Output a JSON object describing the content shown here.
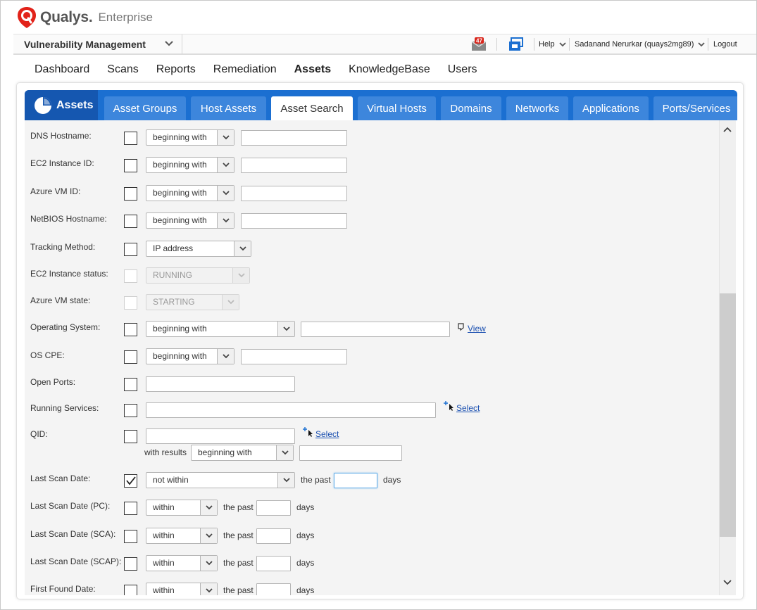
{
  "brand": {
    "name": "Qualys.",
    "edition": "Enterprise"
  },
  "topbar": {
    "module": "Vulnerability Management",
    "mail_count": "47",
    "help": "Help",
    "user": "Sadanand Nerurkar (quays2mg89)",
    "logout": "Logout"
  },
  "nav": [
    "Dashboard",
    "Scans",
    "Reports",
    "Remediation",
    "Assets",
    "KnowledgeBase",
    "Users"
  ],
  "tabs": {
    "home": "Assets",
    "items": [
      "Asset Groups",
      "Host Assets",
      "Asset Search",
      "Virtual Hosts",
      "Domains",
      "Networks",
      "Applications",
      "Ports/Services"
    ]
  },
  "form": {
    "dns_hostname": {
      "label": "DNS Hostname:",
      "operator": "beginning with"
    },
    "ec2_instance_id": {
      "label": "EC2 Instance ID:",
      "operator": "beginning with"
    },
    "azure_vm_id": {
      "label": "Azure VM ID:",
      "operator": "beginning with"
    },
    "netbios_hostname": {
      "label": "NetBIOS Hostname:",
      "operator": "beginning with"
    },
    "tracking_method": {
      "label": "Tracking Method:",
      "value": "IP address"
    },
    "ec2_instance_status": {
      "label": "EC2 Instance status:",
      "value": "RUNNING"
    },
    "azure_vm_state": {
      "label": "Azure VM state:",
      "value": "STARTING"
    },
    "operating_system": {
      "label": "Operating System:",
      "operator": "beginning with",
      "link": "View"
    },
    "os_cpe": {
      "label": "OS CPE:",
      "operator": "beginning with"
    },
    "open_ports": {
      "label": "Open Ports:"
    },
    "running_services": {
      "label": "Running Services:",
      "link": "Select"
    },
    "qid": {
      "label": "QID:",
      "link": "Select",
      "with_results": "with results",
      "operator": "beginning with"
    },
    "last_scan_date": {
      "label": "Last Scan Date:",
      "operator": "not within",
      "the_past": "the past",
      "days": "days",
      "checked": true
    },
    "last_scan_date_pc": {
      "label": "Last Scan Date (PC):",
      "operator": "within",
      "the_past": "the past",
      "days": "days"
    },
    "last_scan_date_sca": {
      "label": "Last Scan Date (SCA):",
      "operator": "within",
      "the_past": "the past",
      "days": "days"
    },
    "last_scan_date_scap": {
      "label": "Last Scan Date (SCAP):",
      "operator": "within",
      "the_past": "the past",
      "days": "days"
    },
    "first_found_date": {
      "label": "First Found Date:",
      "operator": "within",
      "the_past": "the past",
      "days": "days"
    }
  },
  "icons": {
    "chevron": "chevron-down-icon",
    "mail": "mail-icon",
    "notifications": "notification-icon",
    "view": "view-icon",
    "select": "add-select-icon"
  },
  "colors": {
    "tab_blue": "#1b6fd1",
    "tab_dark": "#1557b0",
    "tab_light": "#3d86dc",
    "brand_red": "#e2231a",
    "link": "#1a4fb0"
  }
}
